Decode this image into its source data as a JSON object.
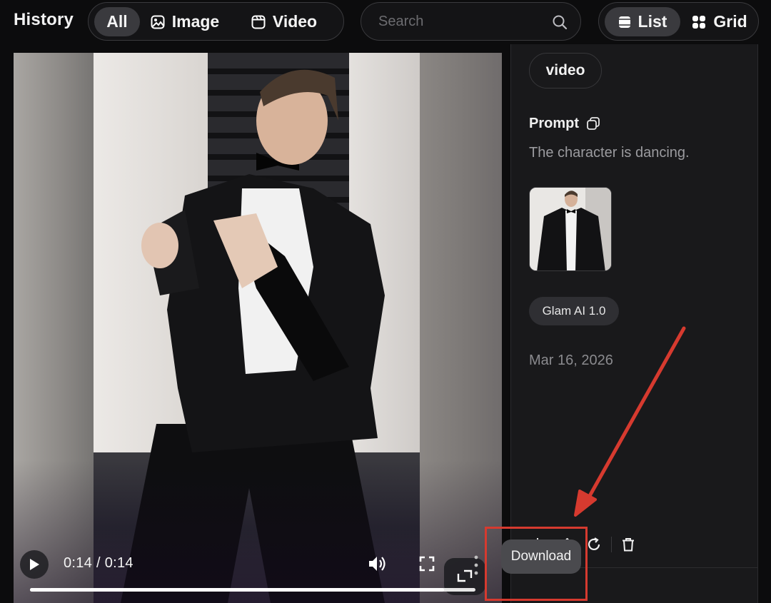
{
  "header": {
    "title": "History",
    "filters": [
      {
        "label": "All",
        "icon": "",
        "active": true
      },
      {
        "label": "Image",
        "icon": "image-icon",
        "active": false
      },
      {
        "label": "Video",
        "icon": "video-icon",
        "active": false
      }
    ],
    "search": {
      "placeholder": "Search",
      "value": ""
    },
    "views": [
      {
        "label": "List",
        "icon": "list-icon",
        "active": true
      },
      {
        "label": "Grid",
        "icon": "grid-icon",
        "active": false
      }
    ]
  },
  "player": {
    "current_time": "0:14",
    "separator": "/",
    "duration": "0:14",
    "progress_fraction": 0.93
  },
  "details": {
    "type": "video",
    "prompt_label": "Prompt",
    "prompt_text": "The character is dancing.",
    "model": "Glam AI 1.0",
    "date": "Mar 16, 2026"
  },
  "actions": {
    "download_tooltip": "Download"
  },
  "colors": {
    "annotation": "#d63a2f",
    "background": "#0c0c0d",
    "panel": "#19191b"
  }
}
